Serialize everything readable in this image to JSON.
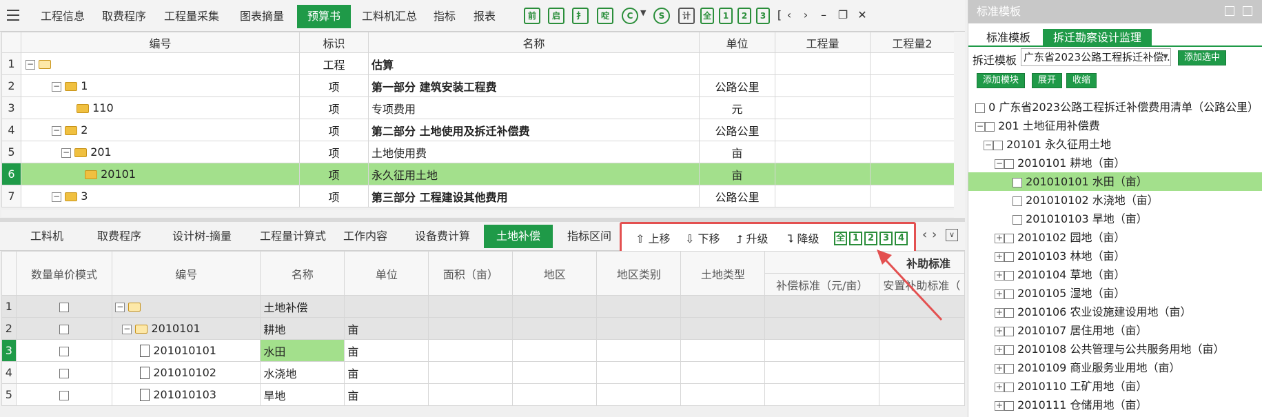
{
  "top_tabs": [
    "工程信息",
    "取费程序",
    "工程量采集",
    "图表摘量",
    "预算书",
    "工料机汇总",
    "指标",
    "报表"
  ],
  "top_tab_active": "预算书",
  "toolbar_icons": [
    "前",
    "启",
    "扌",
    "啶",
    "C",
    "S",
    "计"
  ],
  "toolbar_nums": [
    "全",
    "1",
    "2",
    "3"
  ],
  "grid1": {
    "headers": [
      "编号",
      "标识",
      "名称",
      "单位",
      "工程量",
      "工程量2"
    ],
    "rows": [
      {
        "n": "1",
        "code": "",
        "mark": "工程",
        "name": "估算",
        "unit": "",
        "bold": true
      },
      {
        "n": "2",
        "code": "1",
        "mark": "项",
        "name": "第一部分 建筑安装工程费",
        "unit": "公路公里",
        "bold": true
      },
      {
        "n": "3",
        "code": "110",
        "mark": "项",
        "name": "专项费用",
        "unit": "元",
        "bold": false
      },
      {
        "n": "4",
        "code": "2",
        "mark": "项",
        "name": "第二部分 土地使用及拆迁补偿费",
        "unit": "公路公里",
        "bold": true
      },
      {
        "n": "5",
        "code": "201",
        "mark": "项",
        "name": "土地使用费",
        "unit": "亩",
        "bold": false
      },
      {
        "n": "6",
        "code": "20101",
        "mark": "项",
        "name": "永久征用土地",
        "unit": "亩",
        "bold": false
      },
      {
        "n": "7",
        "code": "3",
        "mark": "项",
        "name": "第三部分 工程建设其他费用",
        "unit": "公路公里",
        "bold": true
      }
    ]
  },
  "bottom_tabs": [
    "工料机",
    "取费程序",
    "设计树-摘量",
    "工程量计算式",
    "工作内容",
    "设备费计算",
    "土地补偿",
    "指标区间"
  ],
  "bottom_tab_active": "土地补偿",
  "bottom_toolbar": {
    "up": "上移",
    "down": "下移",
    "promote": "升级",
    "demote": "降级",
    "nums": [
      "全",
      "1",
      "2",
      "3",
      "4"
    ]
  },
  "grid2": {
    "headers": [
      "数量单价模式",
      "编号",
      "名称",
      "单位",
      "面积（亩）",
      "地区",
      "地区类别",
      "土地类型"
    ],
    "group_header": "补助标准",
    "sub_headers": [
      "补偿标准（元/亩）",
      "安置补助标准（"
    ],
    "rows": [
      {
        "n": "1",
        "code": "",
        "name": "土地补偿",
        "unit": ""
      },
      {
        "n": "2",
        "code": "2010101",
        "name": "耕地",
        "unit": "亩"
      },
      {
        "n": "3",
        "code": "201010101",
        "name": "水田",
        "unit": "亩"
      },
      {
        "n": "4",
        "code": "201010102",
        "name": "水浇地",
        "unit": "亩"
      },
      {
        "n": "5",
        "code": "201010103",
        "name": "旱地",
        "unit": "亩"
      }
    ]
  },
  "right_panel": {
    "title": "标准模板",
    "tabs": [
      "标准模板",
      "拆迁勘察设计监理"
    ],
    "tab_active": "拆迁勘察设计监理",
    "template_label": "拆迁模板",
    "template_value": "广东省2023公路工程拆迁补偿...",
    "add_selected": "添加选中",
    "add_module": "添加模块",
    "expand": "展开",
    "collapse": "收缩",
    "tree": [
      {
        "text": "0 广东省2023公路工程拆迁补偿费用清单（公路公里）",
        "level": 0,
        "toggle": ""
      },
      {
        "text": "201 土地征用补偿费",
        "level": 0,
        "toggle": "−"
      },
      {
        "text": "20101 永久征用土地",
        "level": 1,
        "toggle": "−"
      },
      {
        "text": "2010101 耕地（亩）",
        "level": 2,
        "toggle": "−"
      },
      {
        "text": "201010101 水田（亩）",
        "level": 3,
        "toggle": "",
        "hl": true
      },
      {
        "text": "201010102 水浇地（亩）",
        "level": 3,
        "toggle": ""
      },
      {
        "text": "201010103 旱地（亩）",
        "level": 3,
        "toggle": ""
      },
      {
        "text": "2010102 园地（亩）",
        "level": 2,
        "toggle": "+"
      },
      {
        "text": "2010103 林地（亩）",
        "level": 2,
        "toggle": "+"
      },
      {
        "text": "2010104 草地（亩）",
        "level": 2,
        "toggle": "+"
      },
      {
        "text": "2010105 湿地（亩）",
        "level": 2,
        "toggle": "+"
      },
      {
        "text": "2010106 农业设施建设用地（亩）",
        "level": 2,
        "toggle": "+"
      },
      {
        "text": "2010107 居住用地（亩）",
        "level": 2,
        "toggle": "+"
      },
      {
        "text": "2010108 公共管理与公共服务用地（亩）",
        "level": 2,
        "toggle": "+"
      },
      {
        "text": "2010109 商业服务业用地（亩）",
        "level": 2,
        "toggle": "+"
      },
      {
        "text": "2010110 工矿用地（亩）",
        "level": 2,
        "toggle": "+"
      },
      {
        "text": "2010111 仓储用地（亩）",
        "level": 2,
        "toggle": "+"
      }
    ]
  },
  "colors": {
    "accent": "#1f9a48",
    "highlight": "#a3e08c",
    "annotation": "#e35050"
  }
}
